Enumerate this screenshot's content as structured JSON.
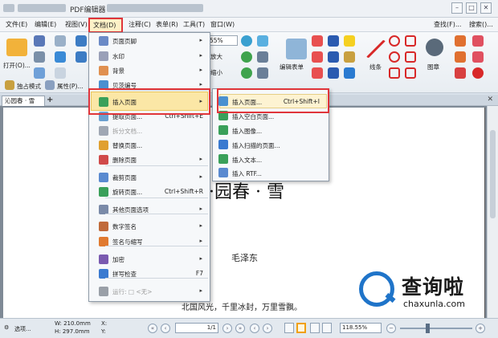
{
  "title": "PDF编辑器",
  "window_controls": {
    "min": "–",
    "max": "□",
    "close": "✕"
  },
  "menu": [
    "文件(E)",
    "编辑(E)",
    "视图(V)",
    "文档(D)",
    "注释(C)",
    "表单(R)",
    "工具(T)",
    "窗口(W)"
  ],
  "menu_right": {
    "find": "查找(F)...",
    "search": "搜索()..."
  },
  "ribbon": {
    "open": "打开(O)...",
    "zoom_value": "55%",
    "zoom_in": "放大",
    "zoom_out": "缩小",
    "edit_form": "编辑表单",
    "lines": "线条",
    "stamp": "图章",
    "exclusive_mode": "独占模式",
    "properties": "属性(P)..."
  },
  "tabs": {
    "document": "沁园春 · 雪",
    "add": "+",
    "close": "✕"
  },
  "document_menu": {
    "items": [
      {
        "icon": "header-footer-icon",
        "label": "页面页脚",
        "shortcut": "",
        "arrow": "▸",
        "disabled": false
      },
      {
        "icon": "watermark-icon",
        "label": "水印",
        "shortcut": "",
        "arrow": "▸",
        "disabled": false
      },
      {
        "icon": "background-icon",
        "label": "背景",
        "shortcut": "",
        "arrow": "▸",
        "disabled": false
      },
      {
        "icon": "bates-number-icon",
        "label": "贝茨编号",
        "shortcut": "",
        "arrow": "▸",
        "disabled": false
      },
      {
        "icon": "insert-page-icon",
        "label": "插入页面",
        "shortcut": "",
        "arrow": "▸",
        "disabled": false
      },
      {
        "icon": "extract-page-icon",
        "label": "提取页面...",
        "shortcut": "Ctrl+Shift+E",
        "arrow": "",
        "disabled": false
      },
      {
        "icon": "split-document-icon",
        "label": "拆分文档...",
        "shortcut": "",
        "arrow": "",
        "disabled": true
      },
      {
        "icon": "replace-page-icon",
        "label": "替换页面...",
        "shortcut": "",
        "arrow": "",
        "disabled": false
      },
      {
        "icon": "delete-page-icon",
        "label": "删除页面",
        "shortcut": "",
        "arrow": "▸",
        "disabled": false
      },
      {
        "icon": "crop-page-icon",
        "label": "裁剪页面",
        "shortcut": "",
        "arrow": "▸",
        "disabled": false
      },
      {
        "icon": "rotate-page-icon",
        "label": "旋转页面...",
        "shortcut": "Ctrl+Shift+R",
        "arrow": "",
        "disabled": false
      },
      {
        "icon": "more-page-options-icon",
        "label": "其他页面选项",
        "shortcut": "",
        "arrow": "▸",
        "disabled": false
      },
      {
        "icon": "digital-signature-icon",
        "label": "数字签名",
        "shortcut": "",
        "arrow": "▸",
        "disabled": false
      },
      {
        "icon": "sign-initials-icon",
        "label": "签名与缩写",
        "shortcut": "",
        "arrow": "▸",
        "disabled": false
      },
      {
        "icon": "encrypt-icon",
        "label": "加密",
        "shortcut": "",
        "arrow": "▸",
        "disabled": false
      },
      {
        "icon": "spell-check-icon",
        "label": "拼写检查",
        "shortcut": "F7",
        "arrow": "",
        "disabled": false
      },
      {
        "icon": "run-icon",
        "label": "运行: □ <无>",
        "shortcut": "",
        "arrow": "▸",
        "disabled": true
      }
    ]
  },
  "insert_submenu": {
    "items": [
      {
        "icon": "insert-page-file-icon",
        "label": "插入页面...",
        "shortcut": "Ctrl+Shift+I"
      },
      {
        "icon": "insert-blank-page-icon",
        "label": "插入空白页面...",
        "shortcut": ""
      },
      {
        "icon": "insert-image-icon",
        "label": "插入图像...",
        "shortcut": ""
      },
      {
        "icon": "insert-scanned-page-icon",
        "label": "插入扫描的页面...",
        "shortcut": ""
      },
      {
        "icon": "insert-text-icon",
        "label": "插入文本...",
        "shortcut": ""
      },
      {
        "icon": "insert-rtf-icon",
        "label": "插入 RTF...",
        "shortcut": ""
      }
    ]
  },
  "document_content": {
    "title": "·园春 · 雪",
    "author": "毛泽东",
    "line1": "北国风光，千里冰封，万里雪飘。"
  },
  "status": {
    "select": "选项...",
    "width": "W: 210.0mm",
    "height": "H: 297.0mm",
    "x": "X:",
    "y": "Y:",
    "page": "1/1",
    "zoom": "118.55%"
  },
  "watermark": {
    "text": "查询啦",
    "url": "chaxunla.com"
  }
}
